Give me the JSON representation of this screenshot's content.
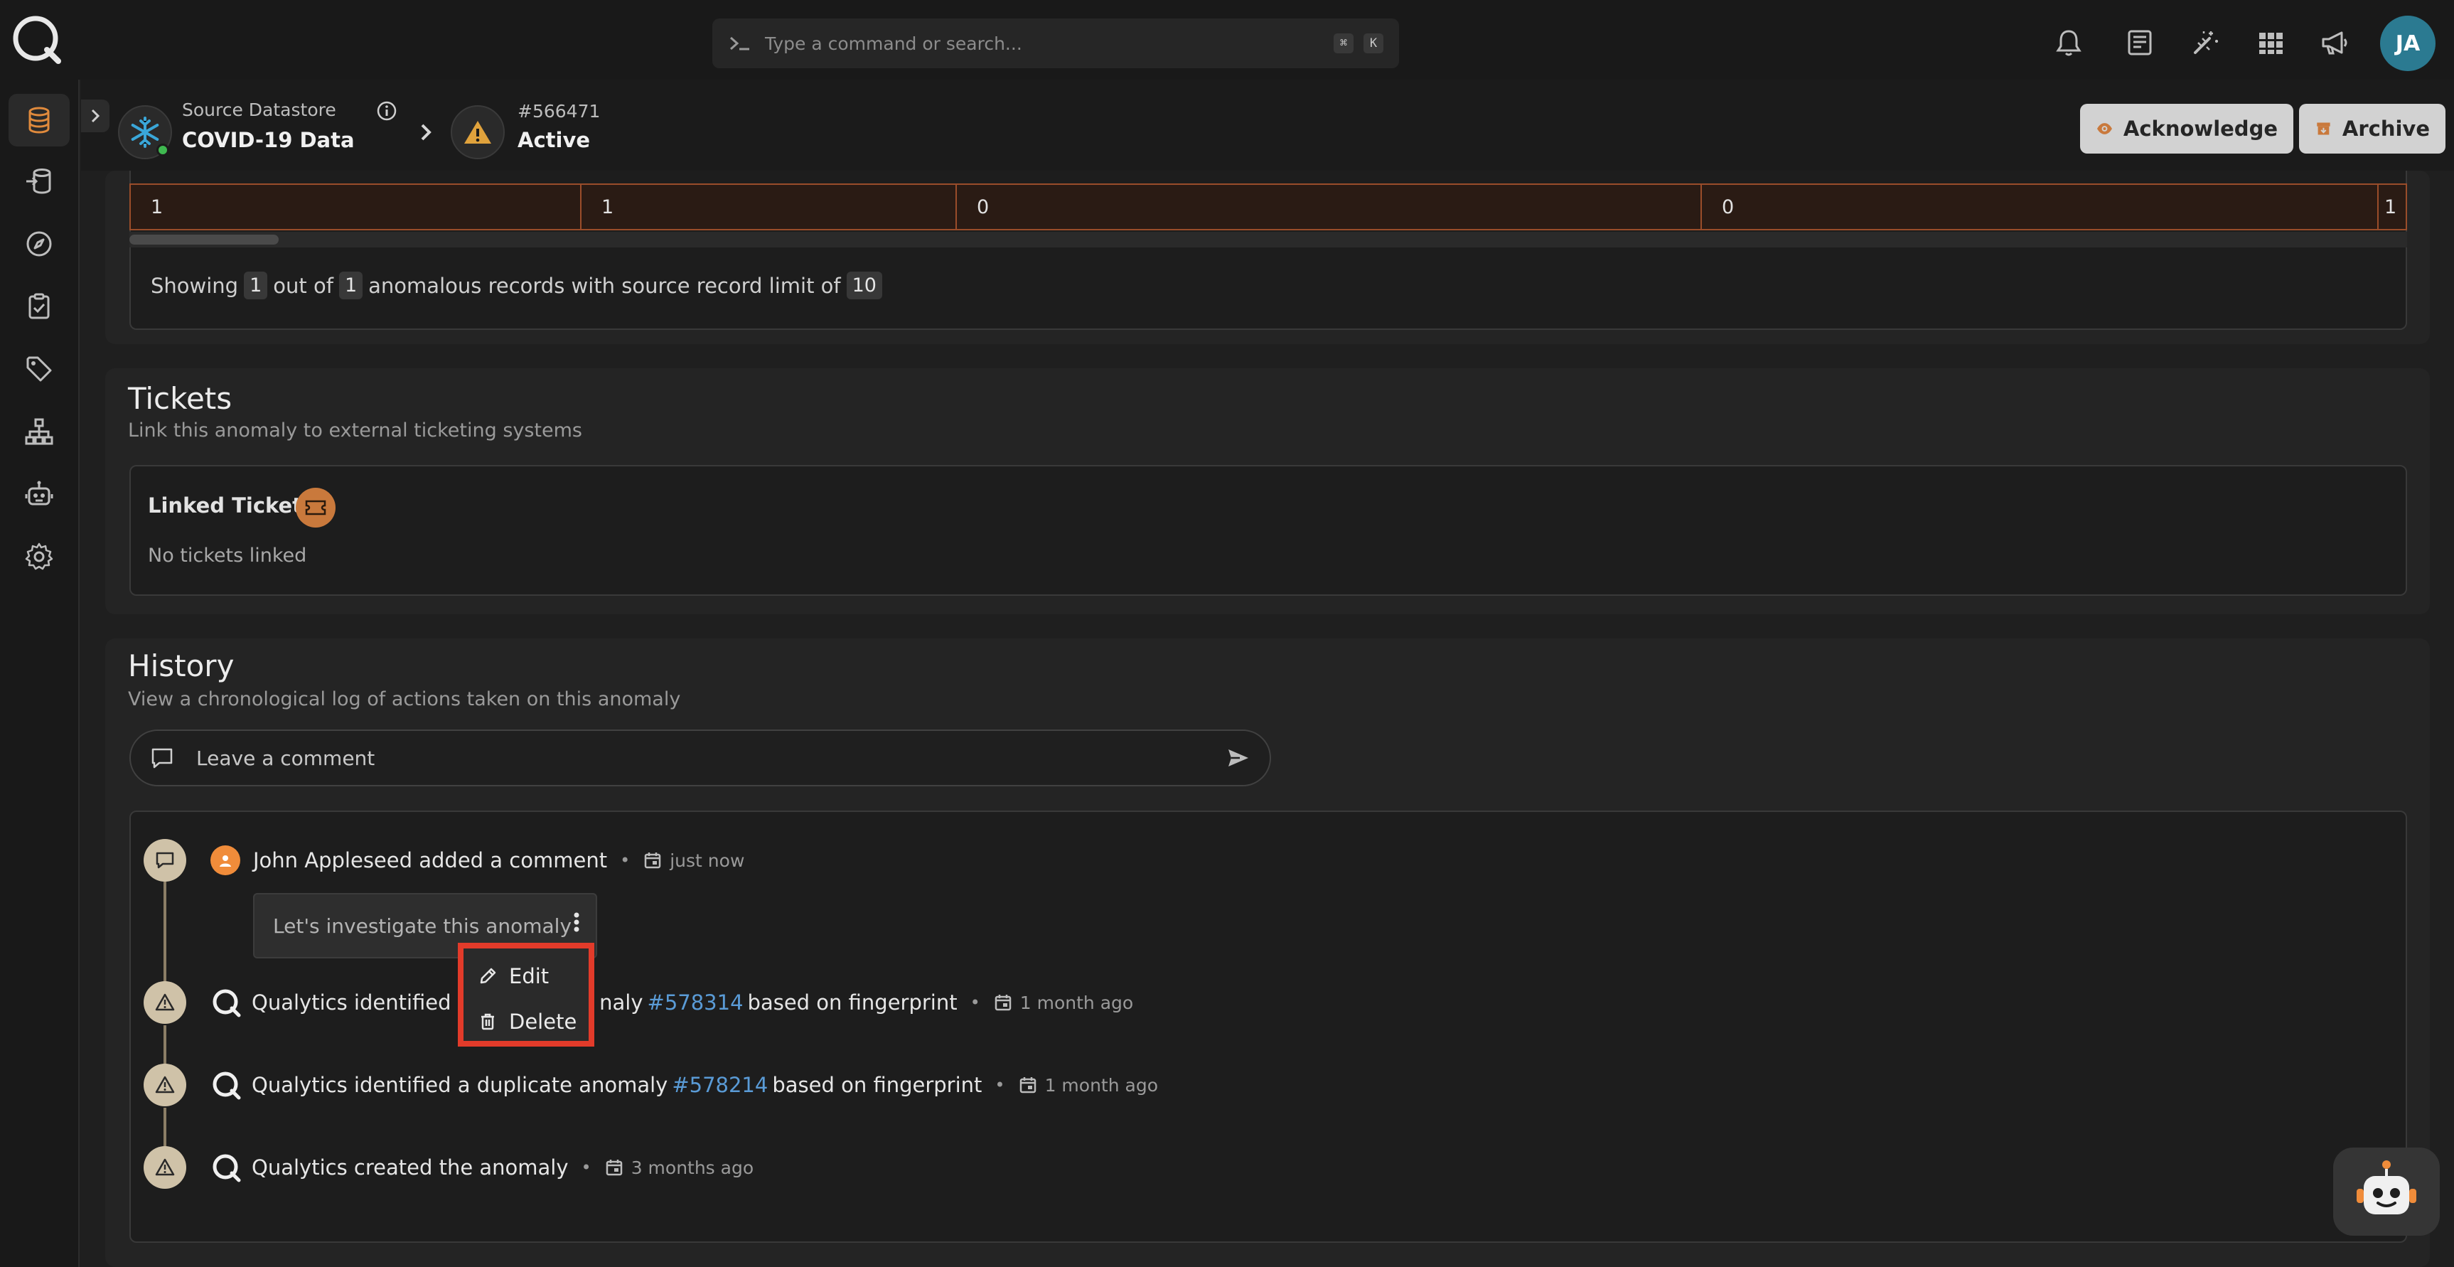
{
  "topbar": {
    "search_placeholder": "Type a command or search...",
    "shortcut_keys": [
      "⌘",
      "K"
    ],
    "user_initials": "JA"
  },
  "header": {
    "datastore_label": "Source Datastore",
    "datastore_name": "COVID-19 Data",
    "anomaly_id": "#566471",
    "anomaly_status": "Active",
    "acknowledge_label": "Acknowledge",
    "archive_label": "Archive"
  },
  "records": {
    "row_values": [
      "1",
      "1",
      "0",
      "0",
      "1"
    ],
    "showing_prefix": "Showing",
    "shown_count": "1",
    "out_of_label": "out of",
    "total_count": "1",
    "middle_text": "anomalous records with source record limit of",
    "limit": "10"
  },
  "tickets": {
    "title": "Tickets",
    "subtitle": "Link this anomaly to external ticketing systems",
    "linked_label": "Linked Tickets",
    "empty_text": "No tickets linked"
  },
  "history": {
    "title": "History",
    "subtitle": "View a chronological log of actions taken on this anomaly",
    "comment_placeholder": "Leave a comment",
    "events": [
      {
        "actor": "John Appleseed",
        "action": "added a comment",
        "time": "just now",
        "comment": "Let's investigate this anomaly"
      },
      {
        "text_before": "Qualytics identified a duplicate anomaly",
        "visible_before": "Qualytics identified a d",
        "visible_after": "naly",
        "link": "#578314",
        "text_after": "based on fingerprint",
        "time": "1 month ago"
      },
      {
        "text_before": "Qualytics identified a duplicate anomaly",
        "link": "#578214",
        "text_after": "based on fingerprint",
        "time": "1 month ago"
      },
      {
        "text_before": "Qualytics created the anomaly",
        "time": "3 months ago"
      }
    ]
  },
  "context_menu": {
    "edit_label": "Edit",
    "delete_label": "Delete"
  },
  "colors": {
    "accent_orange": "#c9793c",
    "highlight_red": "#e23b2a",
    "link_blue": "#5a9bd6",
    "timeline_icon": "#cfc2a8",
    "avatar_teal": "#2b7a91"
  }
}
